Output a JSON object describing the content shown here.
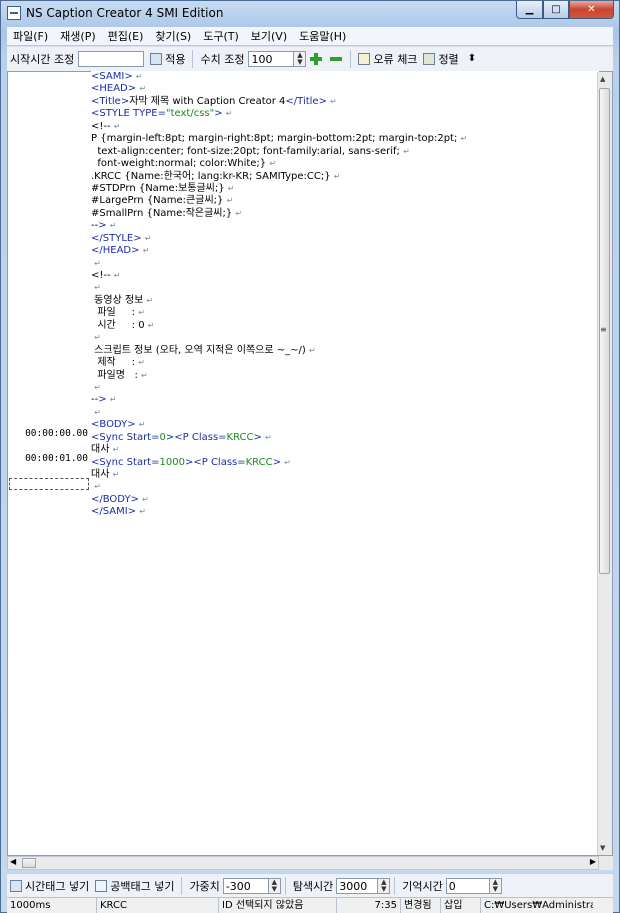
{
  "window": {
    "title": "NS Caption Creator 4 SMI Edition"
  },
  "menu": [
    "파일(F)",
    "재생(P)",
    "편집(E)",
    "찾기(S)",
    "도구(T)",
    "보기(V)",
    "도움말(H)"
  ],
  "toolbar": {
    "start_time_label": "시작시간 조정",
    "start_time_value": "",
    "apply_label": "적용",
    "value_adjust_label": "수치 조정",
    "value_adjust_value": "100",
    "error_check_label": "오류 체크",
    "sort_label": "정렬"
  },
  "gutter": {
    "sync1_time": "00:00:00.00",
    "sync2_time": "00:00:01.00"
  },
  "code_lines": [
    "<SAMI>",
    "<HEAD>",
    "<Title>자막 제목 with Caption Creator 4</Title>",
    "<STYLE TYPE=\"text/css\">",
    "<!--",
    "P {margin-left:8pt; margin-right:8pt; margin-bottom:2pt; margin-top:2pt;",
    "  text-align:center; font-size:20pt; font-family:arial, sans-serif;",
    "  font-weight:normal; color:White;}",
    ".KRCC {Name:한국어; lang:kr-KR; SAMIType:CC;}",
    "#STDPrn {Name:보통글씨;}",
    "#LargePrn {Name:큰글씨;}",
    "#SmallPrn {Name:작은글씨;}",
    "-->",
    "</STYLE>",
    "</HEAD>",
    "",
    "<!--",
    "",
    " 동영상 정보",
    "  파일     :",
    "  시간     : 0",
    "",
    " 스크립트 정보 (오타, 오역 지적은 이쪽으로 ~_~/)",
    "  제작     :",
    "  파일명   :",
    "",
    "-->",
    "",
    "<BODY>",
    "<Sync Start=0><P Class=KRCC>",
    "대사",
    "<Sync Start=1000><P Class=KRCC>",
    "대사",
    "",
    "</BODY>",
    "</SAMI>"
  ],
  "bottombar": {
    "insert_time_tag_label": "시간태그 넣기",
    "insert_blank_tag_label": "공백태그 넣기",
    "weight_label": "가중치",
    "weight_value": "-300",
    "search_time_label": "탐색시간",
    "search_time_value": "3000",
    "memory_time_label": "기억시간",
    "memory_time_value": "0"
  },
  "status": {
    "interval": "1000ms",
    "class": "KRCC",
    "id_state": "ID 선택되지 않았음",
    "cursor": "7:35",
    "modified": "변경됨",
    "insert_mode": "삽입",
    "path": "C:₩Users₩Administra"
  }
}
